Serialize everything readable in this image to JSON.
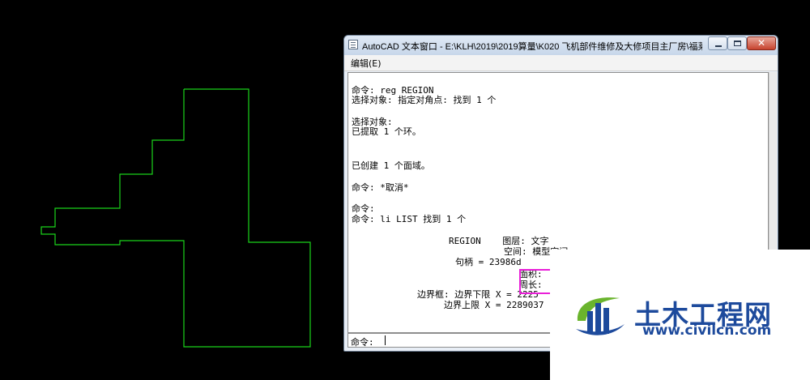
{
  "window": {
    "title": "AutoCAD 文本窗口 - E:\\KLH\\2019\\2019算量\\K020 飞机部件维修及大修项目主厂房\\福莱哈...",
    "menu": [
      "编辑(E)"
    ],
    "close_glyph": "✕"
  },
  "history": [
    "命令: reg REGION",
    "选择对象: 指定对角点: 找到 1 个",
    "选择对象:",
    "已提取 1 个环。",
    "已创建 1 个面域。",
    "命令: *取消*",
    "命令:",
    "命令: li LIST 找到 1 个",
    "REGION    图层: 文字",
    "空间: 模型空间",
    "句柄 = 23986d",
    "面积:",
    "周长:",
    "边界框: 边界下限 X = 2225",
    "边界上限 X = 2289037"
  ],
  "command_prompt": "命令:",
  "colors": {
    "polyline": "#1bd41b",
    "highlight": "#e91fd8",
    "watermark_blue": "#1d4a9c",
    "watermark_green": "#6ab42d"
  },
  "watermark": {
    "name": "土木工程网",
    "url": "www.civilcn.com"
  }
}
